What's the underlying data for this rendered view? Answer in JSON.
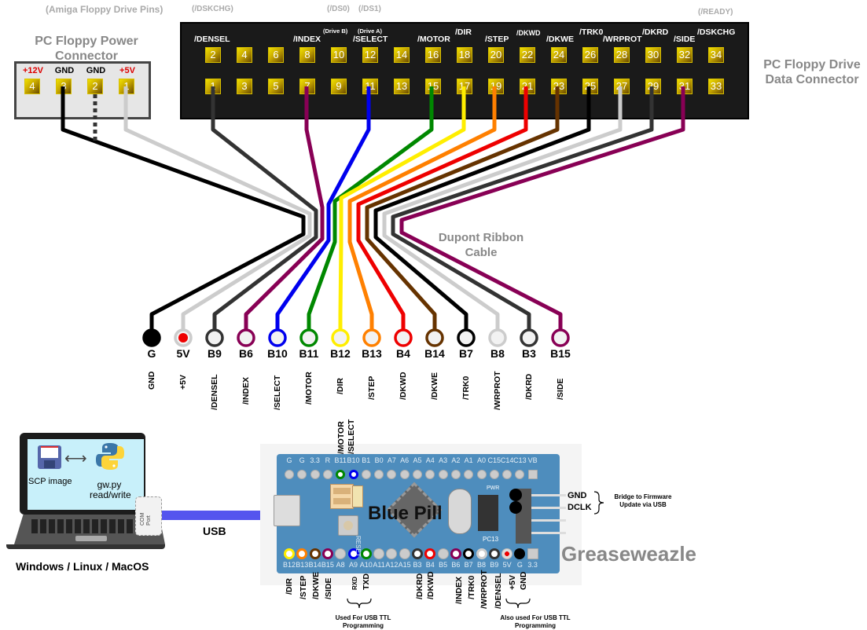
{
  "titles": {
    "amiga_pins": "(Amiga Floppy Drive Pins)",
    "power_connector": "PC Floppy Power Connector",
    "data_connector": "PC Floppy Drive Data Connector",
    "ribbon_cable": "Dupont Ribbon Cable",
    "board_name": "Blue Pill",
    "product_name": "Greaseweazle",
    "usb": "USB",
    "os": "Windows / Linux / MacOS"
  },
  "amiga_labels": {
    "dskchg": "(/DSKCHG)",
    "ds0": "(/DS0)",
    "ds1": "(/DS1)",
    "ready": "(/READY)"
  },
  "power_connector": {
    "pins": [
      {
        "number": "4",
        "label": "+12V",
        "color": "#dd0000"
      },
      {
        "number": "3",
        "label": "GND",
        "color": "#000000"
      },
      {
        "number": "2",
        "label": "GND",
        "color": "#000000"
      },
      {
        "number": "1",
        "label": "+5V",
        "color": "#dd0000"
      }
    ]
  },
  "data_connector": {
    "top_pins": [
      "2",
      "4",
      "6",
      "8",
      "10",
      "12",
      "14",
      "16",
      "18",
      "20",
      "22",
      "24",
      "26",
      "28",
      "30",
      "32",
      "34"
    ],
    "bottom_pins": [
      "1",
      "3",
      "5",
      "7",
      "9",
      "11",
      "13",
      "15",
      "17",
      "19",
      "21",
      "23",
      "25",
      "27",
      "29",
      "31",
      "33"
    ],
    "signal_labels": [
      {
        "pin": "2",
        "label": "/DENSEL"
      },
      {
        "pin": "8",
        "label": "/INDEX"
      },
      {
        "pin": "10",
        "label": "(Drive B)"
      },
      {
        "pin": "12",
        "label": "/SELECT",
        "sub": "(Drive A)"
      },
      {
        "pin": "16",
        "label": "/MOTOR"
      },
      {
        "pin": "18",
        "label": "/DIR"
      },
      {
        "pin": "20",
        "label": "/STEP"
      },
      {
        "pin": "22",
        "label": "/DKWD"
      },
      {
        "pin": "24",
        "label": "/DKWE"
      },
      {
        "pin": "26",
        "label": "/TRK0"
      },
      {
        "pin": "28",
        "label": "/WRPROT"
      },
      {
        "pin": "30",
        "label": "/DKRD"
      },
      {
        "pin": "32",
        "label": "/SIDE"
      },
      {
        "pin": "34",
        "label": "/DSKCHG"
      }
    ]
  },
  "wires": [
    {
      "pin": "G",
      "signal": "GND",
      "color": "#000000",
      "filled": true
    },
    {
      "pin": "5V",
      "signal": "+5V",
      "color": "#cccccc",
      "dot": "#ee0000"
    },
    {
      "pin": "B9",
      "signal": "/DENSEL",
      "color": "#333333"
    },
    {
      "pin": "B6",
      "signal": "/INDEX",
      "color": "#880055"
    },
    {
      "pin": "B10",
      "signal": "/SELECT",
      "color": "#0000ee"
    },
    {
      "pin": "B11",
      "signal": "/MOTOR",
      "color": "#008800"
    },
    {
      "pin": "B12",
      "signal": "/DIR",
      "color": "#ffee00"
    },
    {
      "pin": "B13",
      "signal": "/STEP",
      "color": "#ff8000"
    },
    {
      "pin": "B4",
      "signal": "/DKWD",
      "color": "#ee0000"
    },
    {
      "pin": "B14",
      "signal": "/DKWE",
      "color": "#663300"
    },
    {
      "pin": "B7",
      "signal": "/TRK0",
      "color": "#000000"
    },
    {
      "pin": "B8",
      "signal": "/WRPROT",
      "color": "#cccccc"
    },
    {
      "pin": "B3",
      "signal": "/DKRD",
      "color": "#333333"
    },
    {
      "pin": "B15",
      "signal": "/SIDE",
      "color": "#880055"
    }
  ],
  "laptop": {
    "file_label": "SCP image",
    "tool_label_1": "gw.py",
    "tool_label_2": "read/write",
    "port_label_1": "COM",
    "port_label_2": "Port"
  },
  "board": {
    "top_header_labels": [
      "G",
      "G",
      "3.3",
      "R",
      "B11",
      "B10",
      "B1",
      "B0",
      "A7",
      "A6",
      "A5",
      "A4",
      "A3",
      "A2",
      "A1",
      "A0",
      "C15",
      "C14",
      "C13",
      "VB"
    ],
    "bottom_header_labels": [
      "B12",
      "B13",
      "B14",
      "B15",
      "A8",
      "A9",
      "A10",
      "A11",
      "A12",
      "A15",
      "B3",
      "B4",
      "B5",
      "B6",
      "B7",
      "B8",
      "B9",
      "5V",
      "G",
      "3.3"
    ],
    "top_annotations": [
      "/MOTOR",
      "/SELECT"
    ],
    "bottom_annotations": [
      {
        "label": "/DIR"
      },
      {
        "label": "/STEP"
      },
      {
        "label": "/DKWE"
      },
      {
        "label": "/SIDE"
      },
      {
        "label": "RXD"
      },
      {
        "label": "TXD"
      },
      {
        "label": "/DKRD"
      },
      {
        "label": "/DKWD"
      },
      {
        "label": "/INDEX"
      },
      {
        "label": "/TRK0"
      },
      {
        "label": "/WRPROT"
      },
      {
        "label": "/DENSEL"
      },
      {
        "label": "+5V"
      },
      {
        "label": "GND"
      }
    ],
    "pwr_label": "PWR",
    "pc13_label": "PC13",
    "reset_label": "RESET",
    "jumper_labels": [
      "GND",
      "DCLK"
    ],
    "jumper_note": "Bridge to Firmware Update via USB",
    "ttl_note_1": "Used For USB TTL Programming",
    "ttl_note_2": "Also used For USB TTL Programming"
  }
}
